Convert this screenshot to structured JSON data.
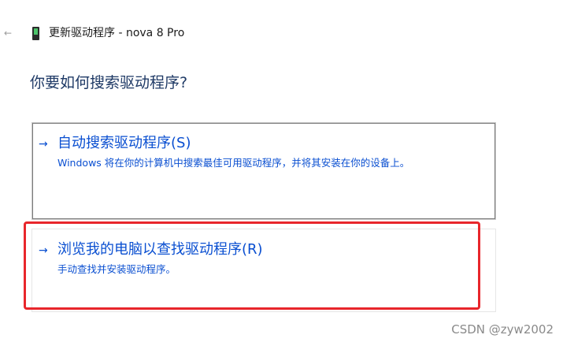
{
  "header": {
    "back_icon": "←",
    "device_icon": "phone-device-icon",
    "title": "更新驱动程序 - nova 8 Pro"
  },
  "question": "你要如何搜索驱动程序?",
  "options": [
    {
      "arrow": "→",
      "title": "自动搜索驱动程序(S)",
      "description": "Windows 将在你的计算机中搜索最佳可用驱动程序，并将其安装在你的设备上。"
    },
    {
      "arrow": "→",
      "title": "浏览我的电脑以查找驱动程序(R)",
      "description": "手动查找并安装驱动程序。"
    }
  ],
  "annotation": {
    "highlight_color": "#e8262b"
  },
  "watermark": "CSDN @zyw2002",
  "colors": {
    "link_blue": "#0a4fd1",
    "heading_navy": "#1f3a66"
  }
}
